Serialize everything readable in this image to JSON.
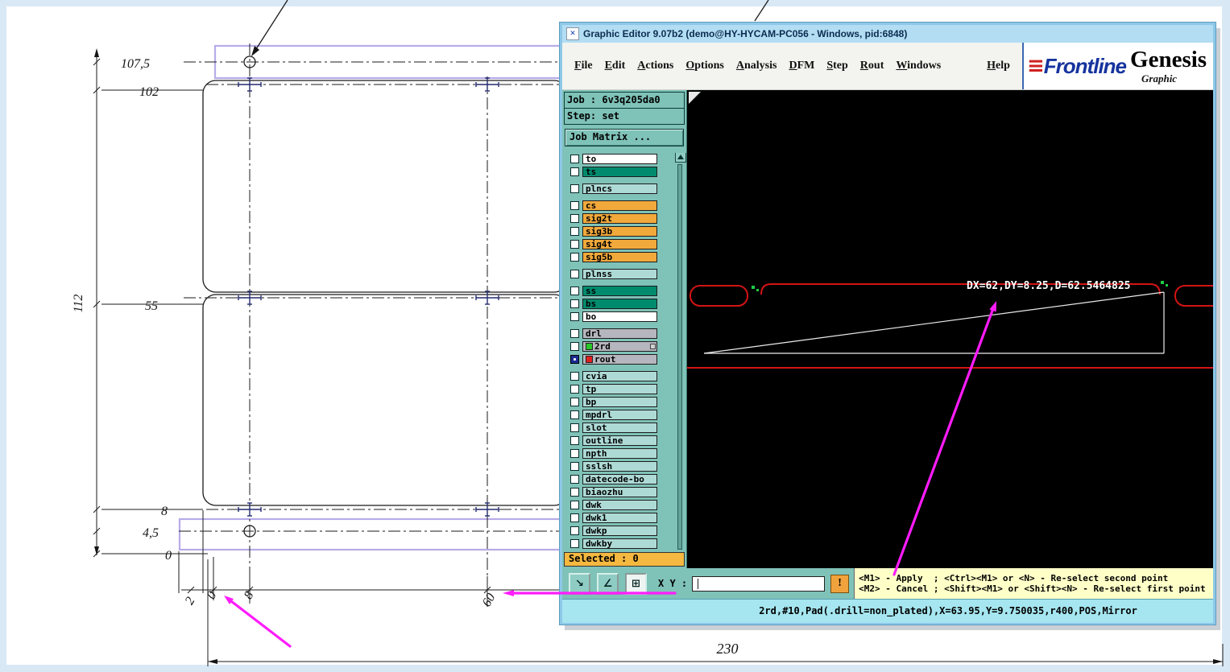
{
  "editor": {
    "title": "Graphic Editor 9.07b2 (demo@HY-HYCAM-PC056 - Windows, pid:6848)",
    "icons": {
      "window_glyph": "✕",
      "frontline_bars": "≡",
      "pointer": "↘",
      "measure": "∠",
      "grid": "⊞"
    },
    "menus": [
      "File",
      "Edit",
      "Actions",
      "Options",
      "Analysis",
      "DFM",
      "Step",
      "Rout",
      "Windows",
      "Help"
    ],
    "logo": {
      "brand": "Frontline",
      "product": "Genesis",
      "product_sub": "Graphic"
    },
    "job_line": "Job : 6v3q205da0",
    "step_line": "Step: set",
    "job_matrix_button": "Job Matrix ...",
    "layers": [
      {
        "name": "to",
        "color": "#ffffff"
      },
      {
        "name": "ts",
        "color": "#008b6e"
      },
      {
        "name": "plncs",
        "color": "#aedad6",
        "gap_before": true
      },
      {
        "name": "cs",
        "color": "#f2a93b",
        "gap_before": true
      },
      {
        "name": "sig2t",
        "color": "#f2a93b"
      },
      {
        "name": "sig3b",
        "color": "#f2a93b"
      },
      {
        "name": "sig4t",
        "color": "#f2a93b"
      },
      {
        "name": "sig5b",
        "color": "#f2a93b"
      },
      {
        "name": "plnss",
        "color": "#aedad6",
        "gap_before": true
      },
      {
        "name": "ss",
        "color": "#008b6e",
        "gap_before": true
      },
      {
        "name": "bs",
        "color": "#008b6e"
      },
      {
        "name": "bo",
        "color": "#ffffff"
      },
      {
        "name": "drl",
        "color": "#b6b6be",
        "gap_before": true
      },
      {
        "name": "2rd",
        "color": "#b6b6be",
        "chip": "#28c828",
        "right_mark": true
      },
      {
        "name": "rout",
        "color": "#b6b6be",
        "chip": "#e02020",
        "checkbox_filled": true
      },
      {
        "name": "cvia",
        "color": "#aedad6",
        "gap_before": true
      },
      {
        "name": "tp",
        "color": "#aedad6"
      },
      {
        "name": "bp",
        "color": "#aedad6"
      },
      {
        "name": "mpdrl",
        "color": "#aedad6"
      },
      {
        "name": "slot",
        "color": "#aedad6"
      },
      {
        "name": "outline",
        "color": "#aedad6"
      },
      {
        "name": "npth",
        "color": "#aedad6"
      },
      {
        "name": "sslsh",
        "color": "#aedad6"
      },
      {
        "name": "datecode-bo",
        "color": "#aedad6"
      },
      {
        "name": "biaozhu",
        "color": "#aedad6"
      },
      {
        "name": "dwk",
        "color": "#aedad6"
      },
      {
        "name": "dwk1",
        "color": "#aedad6"
      },
      {
        "name": "dwkp",
        "color": "#aedad6"
      },
      {
        "name": "dwkby",
        "color": "#aedad6"
      }
    ],
    "selected_label": "Selected : 0",
    "toolbar": {
      "xy_label": "X Y :",
      "xy_value": "",
      "apply_label": "!"
    },
    "hints": {
      "line1": "<M1> - Apply  ; <Ctrl><M1> or <N> - Re-select second point",
      "line2": "<M2> - Cancel ; <Shift><M1> or <Shift><N> - Re-select first point"
    },
    "status": "2rd,#10,Pad(.drill=non_plated),X=63.95,Y=9.750035,r400,POS,Mirror",
    "canvas": {
      "measurement": "DX=62,DY=8.25,D=62.5464825"
    },
    "colors": {
      "panel_teal": "#7fc2b8",
      "hint_yellow": "#ffffc8",
      "status_cyan": "#a5e6f0",
      "selected_orange": "#f5b840",
      "pcb_outline_red": "#d31414",
      "annotation_arrow": "#ff1cfc",
      "drawing_purple": "#b7abe9"
    }
  },
  "drawing": {
    "left_labels": {
      "l107_5": "107,5",
      "l102": "102",
      "l55": "55",
      "l8": "8",
      "l4_5": "4,5",
      "l0": "0"
    },
    "height_label": "112",
    "bottom_labels": {
      "b2": "2",
      "b0": "0",
      "b8": "8",
      "b60": "60"
    },
    "width_label": "230"
  }
}
